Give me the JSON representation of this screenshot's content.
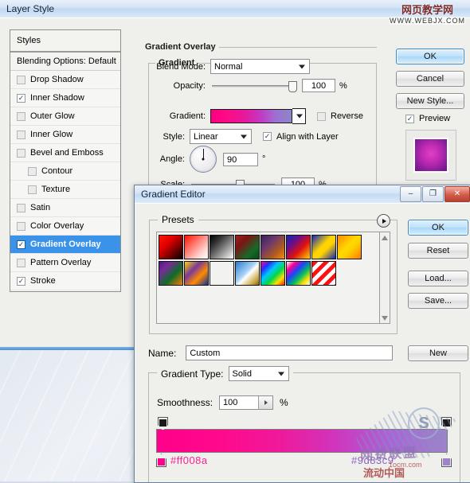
{
  "layer_style": {
    "title": "Layer Style",
    "styles_panel": {
      "header": "Styles",
      "blending_options": "Blending Options: Default",
      "items": [
        {
          "label": "Drop Shadow",
          "checked": false,
          "indent": false,
          "selected": false
        },
        {
          "label": "Inner Shadow",
          "checked": true,
          "indent": false,
          "selected": false
        },
        {
          "label": "Outer Glow",
          "checked": false,
          "indent": false,
          "selected": false
        },
        {
          "label": "Inner Glow",
          "checked": false,
          "indent": false,
          "selected": false
        },
        {
          "label": "Bevel and Emboss",
          "checked": false,
          "indent": false,
          "selected": false
        },
        {
          "label": "Contour",
          "checked": false,
          "indent": true,
          "selected": false
        },
        {
          "label": "Texture",
          "checked": false,
          "indent": true,
          "selected": false
        },
        {
          "label": "Satin",
          "checked": false,
          "indent": false,
          "selected": false
        },
        {
          "label": "Color Overlay",
          "checked": false,
          "indent": false,
          "selected": false
        },
        {
          "label": "Gradient Overlay",
          "checked": true,
          "indent": false,
          "selected": true
        },
        {
          "label": "Pattern Overlay",
          "checked": false,
          "indent": false,
          "selected": false
        },
        {
          "label": "Stroke",
          "checked": true,
          "indent": false,
          "selected": false
        }
      ]
    },
    "gradient_overlay": {
      "group_title": "Gradient Overlay",
      "sub_group_title": "Gradient",
      "blend_mode_label": "Blend Mode:",
      "blend_mode_value": "Normal",
      "opacity_label": "Opacity:",
      "opacity_value": "100",
      "opacity_unit": "%",
      "gradient_label": "Gradient:",
      "reverse_label": "Reverse",
      "reverse_checked": false,
      "style_label": "Style:",
      "style_value": "Linear",
      "align_label": "Align with Layer",
      "align_checked": true,
      "angle_label": "Angle:",
      "angle_value": "90",
      "angle_unit": "°",
      "scale_label": "Scale:",
      "scale_value": "100",
      "scale_unit": "%"
    },
    "buttons": {
      "ok": "OK",
      "cancel": "Cancel",
      "new_style": "New Style...",
      "preview_label": "Preview",
      "preview_checked": true
    }
  },
  "gradient_editor": {
    "title": "Gradient Editor",
    "window_buttons": {
      "minimize": "–",
      "maximize": "❐",
      "close": "✕"
    },
    "presets": {
      "label": "Presets",
      "swatches": [
        {
          "name": "foreground-to-background-red-black",
          "css": "linear-gradient(135deg,#ff1400 0%,#e00000 35%,#6b0000 70%,#060000 100%)"
        },
        {
          "name": "foreground-to-transparent-red",
          "css": "linear-gradient(135deg,#ff1200 0%,#ff8a80 45%,#ffd7d2 75%,#ffffff 100%)"
        },
        {
          "name": "black-white",
          "css": "linear-gradient(135deg,#000000 0%,#3a3a3a 30%,#9b9b9b 65%,#ffffff 100%)"
        },
        {
          "name": "red-green",
          "css": "linear-gradient(135deg,#9b2020 0%,#7d1414 30%,#146b28 70%,#0a4a18 100%)"
        },
        {
          "name": "violet-orange",
          "css": "linear-gradient(135deg,#3b1f5e 0%,#6b3a6b 35%,#b05a20 70%,#ff8c00 100%)"
        },
        {
          "name": "blue-red-yellow",
          "css": "linear-gradient(135deg,#1026b0 0%,#6a0e8a 30%,#e01010 60%,#ffd400 100%)"
        },
        {
          "name": "blue-yellow-blue",
          "css": "linear-gradient(135deg,#0f26b8 0%,#ffd400 45%,#ffd400 60%,#0f26b8 100%)"
        },
        {
          "name": "orange-yellow-orange",
          "css": "linear-gradient(135deg,#ff8a00 0%,#ffd900 45%,#ffcf00 60%,#ff7a00 100%)"
        },
        {
          "name": "violet-green-orange",
          "css": "linear-gradient(135deg,#4a1a7a 0%,#7a2a9a 25%,#0e6b2a 60%,#ff7a00 100%)"
        },
        {
          "name": "yellow-violet-orange-blue",
          "css": "linear-gradient(135deg,#ffd400 0%,#7a3a9a 35%,#ff8a00 65%,#10309a 100%)"
        },
        {
          "name": "copper",
          "css": "linear-gradient(135deg,#5a3020 0%,#a8apa 20%,#c98c6a 50%,#f2d8c8 75%,#8a5a3a 100%)"
        },
        {
          "name": "chrome",
          "css": "linear-gradient(135deg,#2b7ad0 0%,#a8d4f5 45%,#ffffff 55%,#c9a23a 85%,#7a6010 100%)"
        },
        {
          "name": "spectrum",
          "css": "linear-gradient(135deg,#ff00a0 0%,#2030ff 20%,#00c8ff 40%,#00d848 60%,#ffe000 80%,#ff2000 100%)"
        },
        {
          "name": "transparent-rainbow",
          "css": "linear-gradient(135deg,#ffffff 0%,#ff0090 20%,#2040ff 40%,#00c060 62%,#ffe000 82%,#ffffff 100%)"
        },
        {
          "name": "transparent-stripes",
          "css": "repeating-linear-gradient(135deg,#ff1010 0 5px,#ffffff 5px 10px)"
        }
      ]
    },
    "name_label": "Name:",
    "name_value": "Custom",
    "gradient_type_label": "Gradient Type:",
    "gradient_type_value": "Solid",
    "smoothness_label": "Smoothness:",
    "smoothness_value": "100",
    "smoothness_unit": "%",
    "buttons": {
      "ok": "OK",
      "reset": "Reset",
      "load": "Load...",
      "save": "Save...",
      "new": "New"
    },
    "gradient_stops": {
      "left_hex": "#ff008a",
      "right_hex": "#9d83c9"
    }
  },
  "watermarks": {
    "top_cn": "网页教学网",
    "top_url": "WWW.WEBJX.COM",
    "bottom_cn": "网费联盟",
    "bottom_cn2": "流动中国",
    "bottom_url": "1ocm.com",
    "ring_letter": "S"
  },
  "colors": {
    "accent": "#3a93e8",
    "gradient_start": "#ff008a",
    "gradient_end": "#9d83c9",
    "title_close": "#b8422f"
  }
}
